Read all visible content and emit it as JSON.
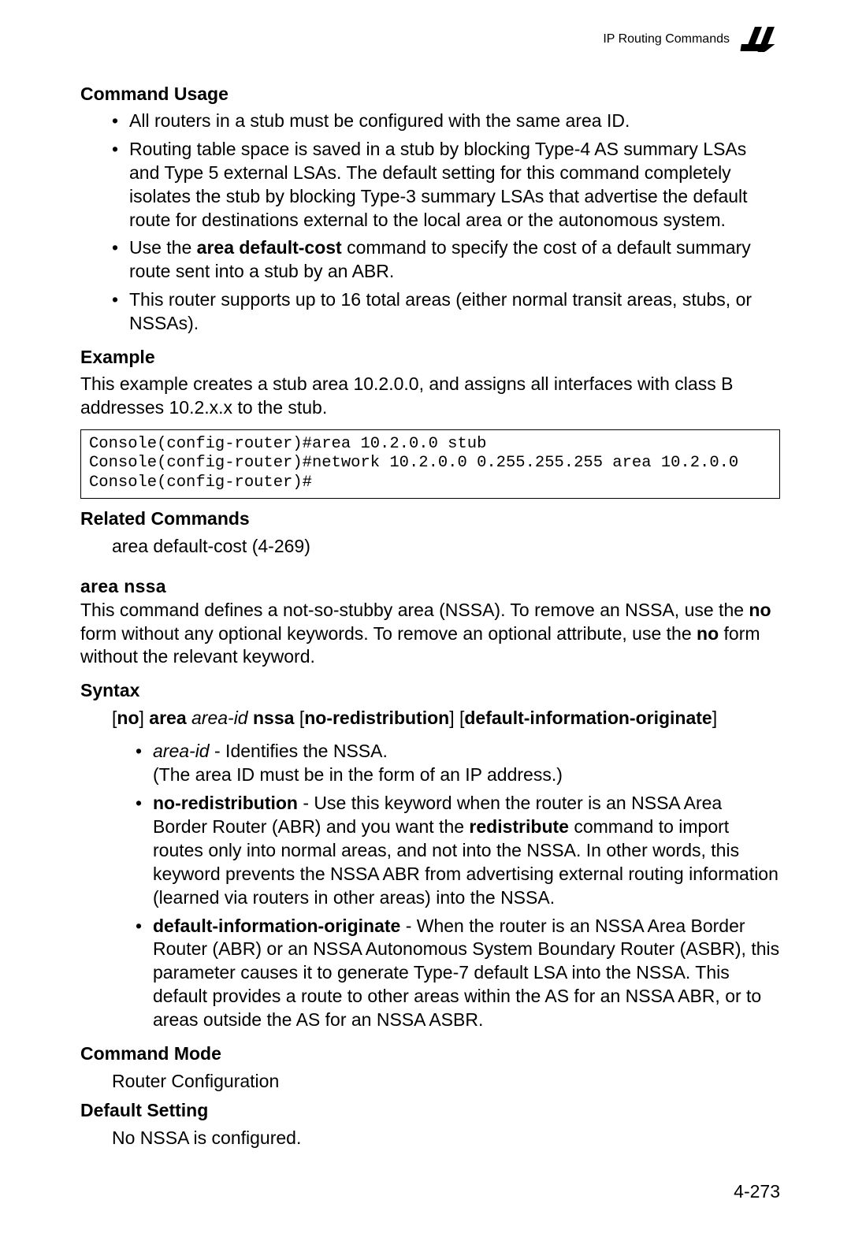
{
  "header": {
    "title": "IP Routing Commands",
    "chapter": "4"
  },
  "sections": {
    "commandUsage": {
      "heading": "Command Usage",
      "items": {
        "i0": "All routers in a stub must be configured with the same area ID.",
        "i1": "Routing table space is saved in a stub by blocking Type-4 AS summary LSAs and Type 5 external LSAs. The default setting for this command completely isolates the stub by blocking Type-3 summary LSAs that advertise the default route for destinations external to the local area or the autonomous system.",
        "i2_pre": "Use the ",
        "i2_bold": "area default-cost",
        "i2_post": " command to specify the cost of a default summary route sent into a stub by an ABR.",
        "i3": "This router supports up to 16 total areas (either normal transit areas, stubs, or NSSAs)."
      }
    },
    "example": {
      "heading": "Example",
      "desc": "This example creates a stub area 10.2.0.0, and assigns all interfaces with class B addresses 10.2.x.x to the stub.",
      "code": "Console(config-router)#area 10.2.0.0 stub\nConsole(config-router)#network 10.2.0.0 0.255.255.255 area 10.2.0.0\nConsole(config-router)#"
    },
    "related": {
      "heading": "Related Commands",
      "line": "area default-cost (4-269)"
    },
    "areaNssa": {
      "name": "area nssa",
      "desc_parts": {
        "p1": "This command defines a not-so-stubby area (NSSA). To remove an NSSA, use the ",
        "b1": "no",
        "p2": " form without any optional keywords. To remove an optional attribute, use the ",
        "b2": "no",
        "p3": " form without the relevant keyword."
      },
      "syntax": {
        "heading": "Syntax",
        "parts": {
          "lbr1": "[",
          "no": "no",
          "rbr1": "] ",
          "area": "area",
          "sp1": " ",
          "areaid": "area-id",
          "sp2": " ",
          "nssa": "nssa",
          "sp3": " ",
          "lbr2": "[",
          "nored": "no-redistribution",
          "rbr2": "] ",
          "lbr3": "[",
          "defi": "default-information-originate",
          "rbr3": "]"
        }
      },
      "params": {
        "p0_term": "area-id",
        "p0_rest": " - Identifies the NSSA.\n(The area ID must be in the form of an IP address.)",
        "p1_term": "no-redistribution",
        "p1_mid": " - Use this keyword when the router is an NSSA Area Border Router (ABR) and you want the ",
        "p1_bold": "redistribute",
        "p1_rest": " command to import routes only into normal areas, and not into the NSSA. In other words, this keyword prevents the NSSA ABR from advertising external routing information (learned via routers in other areas) into the NSSA.",
        "p2_term": "default-information-originate",
        "p2_rest": " - When the router is an NSSA Area Border Router (ABR) or an NSSA Autonomous System Boundary Router (ASBR), this parameter causes it to generate Type-7 default LSA into the NSSA. This default provides a route to other areas within the AS for an NSSA ABR, or to areas outside the AS for an NSSA ASBR."
      },
      "mode": {
        "heading": "Command Mode",
        "value": "Router Configuration"
      },
      "default": {
        "heading": "Default Setting",
        "value": "No NSSA is configured."
      }
    }
  },
  "footer": {
    "page": "4-273"
  }
}
